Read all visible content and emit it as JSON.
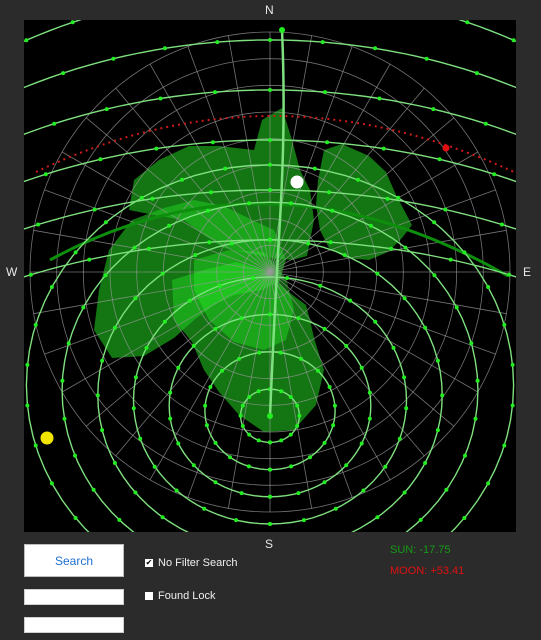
{
  "compass": {
    "north": "N",
    "south": "S",
    "west": "W",
    "east": "E"
  },
  "controls": {
    "search_label": "Search",
    "field1_value": "",
    "field2_value": "",
    "no_filter_label": "No Filter Search",
    "no_filter_checked": true,
    "no_filter_mark": "✔",
    "found_lock_label": "Found Lock",
    "found_lock_checked": false,
    "found_lock_mark": ""
  },
  "status": {
    "sun": "SUN: -17.75",
    "moon": "MOON: +53.41",
    "sun_color": "#159a15",
    "moon_color": "#e01010"
  },
  "colors": {
    "background": "#2b2b2b",
    "plot_background": "#000000",
    "grid": "#9a9a9a",
    "track": "#7ee07e",
    "track_dot": "#22ee22",
    "coverage": "#1fc41f",
    "coverage_bright": "#2aff2a",
    "sun_path": "#d11a1a",
    "moon_marker": "#ffffff",
    "sun_marker": "#f2e600",
    "ecliptic": "#0d8f0d"
  },
  "icons": {
    "check_icon": "checkbox-checked-icon",
    "box_icon": "checkbox-empty-icon"
  }
}
